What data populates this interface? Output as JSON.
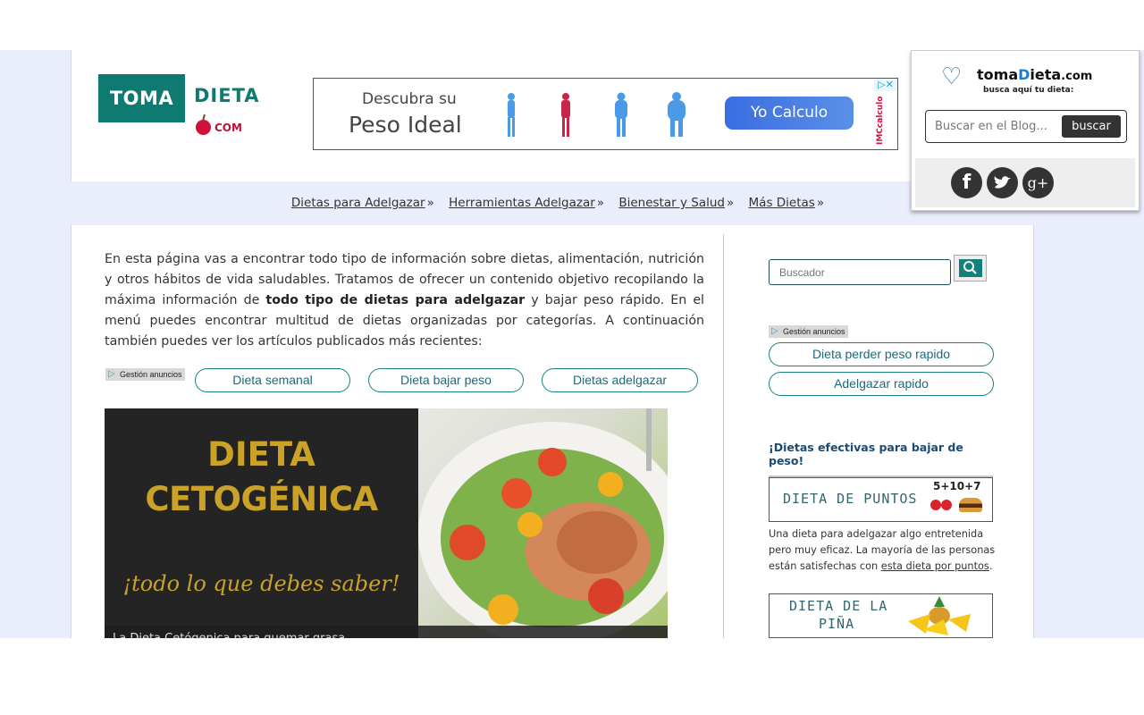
{
  "header": {
    "logo": {
      "toma": "TOMA",
      "dieta": "DIETA",
      "com": "COM"
    },
    "ad_banner": {
      "line1": "Descubra su",
      "line2": "Peso Ideal",
      "cta": "Yo Calculo",
      "adchoices_icon": "adchoices-icon",
      "close_icon": "close-icon",
      "sponsor": "IMCcalculo",
      "figure_colors": [
        "#4a9ae8",
        "#c8254a",
        "#4a9ae8",
        "#4a9ae8"
      ]
    }
  },
  "nav": {
    "items": [
      {
        "label": "Dietas para Adelgazar",
        "suffix": "»"
      },
      {
        "label": "Herramientas Adelgazar",
        "suffix": "»"
      },
      {
        "label": "Bienestar y Salud",
        "suffix": "»"
      },
      {
        "label": "Más Dietas",
        "suffix": "»"
      }
    ]
  },
  "main": {
    "intro_part1": "En esta página vas a encontrar todo tipo de información sobre dietas, alimentación, nutrición y otros hábitos de vida saludables. Tratamos de ofrecer un contenido objetivo recopilando la máxima información de ",
    "intro_bold": "todo tipo de dietas para adelgazar",
    "intro_part2": " y bajar peso rápido. En el menú puedes encontrar multitud de dietas organizadas por categorías. A continuación también puedes ver los artículos publicados más recientes:",
    "ad_label": "Gestión anuncios",
    "ad_links": [
      "Dieta semanal",
      "Dieta bajar peso",
      "Dietas adelgazar"
    ],
    "feature": {
      "title1": "DIETA",
      "title2": "CETOGÉNICA",
      "tagline": "¡todo lo que debes saber!",
      "caption": "La Dieta Cetógenica para quemar grasa"
    }
  },
  "sidebar": {
    "search_placeholder": "Buscador",
    "search_icon": "search-icon",
    "ad_label": "Gestión anuncios",
    "ad_links": [
      "Dieta perder peso rapido",
      "Adelgazar rapido"
    ],
    "section_title": "¡Dietas efectivas para bajar de peso!",
    "promos": [
      {
        "title": "DIETA DE PUNTOS",
        "badge": "5+10+7"
      },
      {
        "title_line1": "DIETA DE LA",
        "title_line2": "PIÑA"
      }
    ],
    "promo_desc_text": "Una dieta para adelgazar algo entretenida pero muy eficaz. La mayoría de las personas están satisfechas con ",
    "promo_desc_link": "esta dieta por puntos",
    "promo_desc_end": "."
  },
  "widget": {
    "brand_prefix": "toma",
    "brand_d": "D",
    "brand_rest": "ieta",
    "brand_tld": ".com",
    "tagline": "busca aquí tu dieta:",
    "search_placeholder": "Buscar en el Blog...",
    "search_button": "buscar",
    "social": [
      {
        "name": "facebook",
        "glyph": "f"
      },
      {
        "name": "twitter",
        "glyph": "t"
      },
      {
        "name": "google-plus",
        "glyph": "g+"
      }
    ]
  },
  "colors": {
    "brand_teal": "#0f7a72",
    "page_bg": "#eaedfb",
    "title_blue": "#1c4a74",
    "gold": "#c9a227"
  }
}
